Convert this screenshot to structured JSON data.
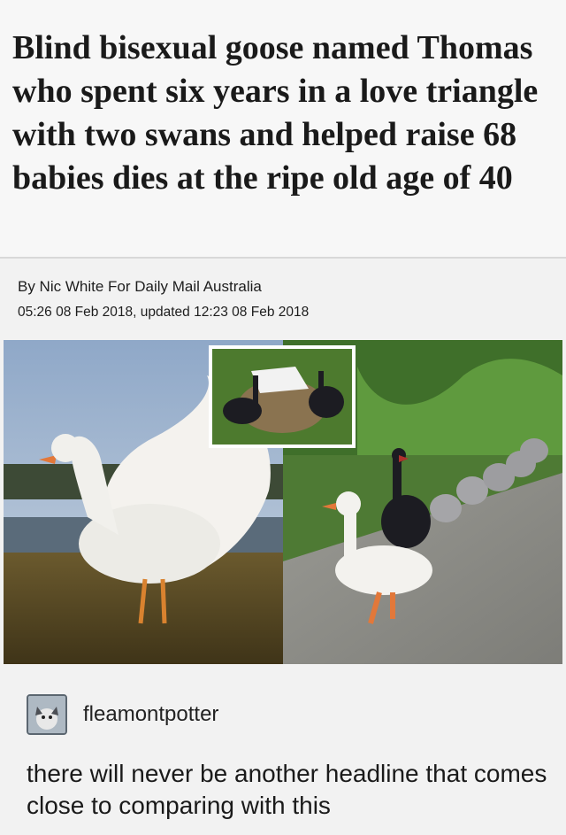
{
  "article": {
    "headline": "Blind bisexual goose named Thomas who spent six years in a love triangle with two swans and helped raise 68 babies dies at the ripe old age of 40",
    "byline": "By Nic White For Daily Mail Australia",
    "timestamp": "05:26 08 Feb 2018, updated 12:23 08 Feb 2018"
  },
  "post": {
    "avatar_icon": "avatar-icon",
    "username": "fleamontpotter",
    "text": "there will never be another headline that comes close to comparing with this"
  },
  "colors": {
    "background": "#f2f2f2",
    "headline_text": "#1a1a1a"
  }
}
